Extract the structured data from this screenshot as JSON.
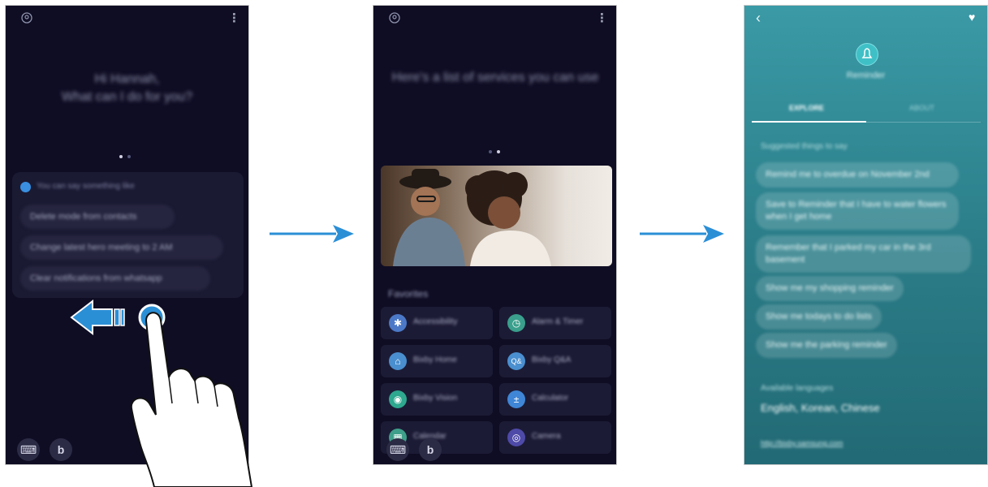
{
  "screen1": {
    "greeting_line1": "Hi Hannah,",
    "greeting_line2": "What can I do for you?",
    "suggest_header": "You can say something like",
    "suggestions": [
      "Delete mode from contacts",
      "Change latest hero meeting to 2 AM",
      "Clear notifications from whatsapp"
    ],
    "icons": {
      "profile": "profile-icon",
      "more": "more-options-icon",
      "keyboard": "keyboard-icon",
      "bixby": "bixby-icon",
      "swipe": "swipe-left-arrow-icon"
    }
  },
  "screen2": {
    "title": "Here's a list of services you can use",
    "section": "Favorites",
    "tiles": [
      {
        "label": "Accessibility",
        "color": "#4b79c7"
      },
      {
        "label": "Alarm & Timer",
        "color": "#3a9f8c"
      },
      {
        "label": "Bixby Home",
        "color": "#4a8fcf"
      },
      {
        "label": "Bixby Q&A",
        "color": "#4a8fcf"
      },
      {
        "label": "Bixby Vision",
        "color": "#2ea88f"
      },
      {
        "label": "Calculator",
        "color": "#3f86d6"
      },
      {
        "label": "Calendar",
        "color": "#3e9f8a"
      },
      {
        "label": "Camera",
        "color": "#4e4aa8"
      }
    ]
  },
  "screen3": {
    "title": "Reminder",
    "tab_active": "EXPLORE",
    "tab_inactive": "ABOUT",
    "section_suggested": "Suggested things to say",
    "phrases": [
      "Remind me to overdue on November 2nd",
      "Save to Reminder that I have to water flowers when I get home",
      "Remember that I parked my car in the 3rd basement",
      "Show me my shopping reminder",
      "Show me todays to do lists",
      "Show me the parking reminder"
    ],
    "section_languages": "Available languages",
    "languages": "English, Korean, Chinese",
    "link": "http://bixby.samsung.com"
  },
  "colors": {
    "accent": "#2b8fd6",
    "dark_bg": "#0f0d24",
    "teal_bg": "#2a7c87"
  }
}
